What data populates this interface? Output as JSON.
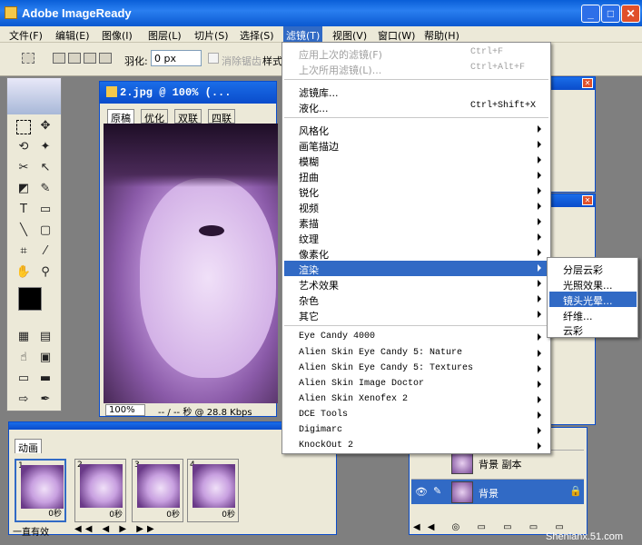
{
  "app": {
    "title": "Adobe ImageReady"
  },
  "menubar": [
    "文件(F)",
    "编辑(E)",
    "图像(I)",
    "图层(L)",
    "切片(S)",
    "选择(S)",
    "滤镜(T)",
    "视图(V)",
    "窗口(W)",
    "帮助(H)"
  ],
  "options": {
    "feather_label": "羽化:",
    "feather_value": "0 px",
    "antialias_label": "消除锯齿",
    "style_label": "样式"
  },
  "document": {
    "title": "2.jpg @ 100% (...",
    "tabs": [
      "原稿",
      "优化",
      "双联",
      "四联"
    ],
    "zoom": "100%",
    "status": "-- / -- 秒 @ 28.8 Kbps"
  },
  "filter_menu": {
    "top": [
      {
        "label": "应用上次的滤镜(F)",
        "shortcut": "Ctrl+F"
      },
      {
        "label": "上次所用滤镜(L)...",
        "shortcut": "Ctrl+Alt+F"
      }
    ],
    "mid": [
      {
        "label": "滤镜库..."
      },
      {
        "label": "液化...",
        "shortcut": "Ctrl+Shift+X"
      }
    ],
    "groups": [
      "风格化",
      "画笔描边",
      "模糊",
      "扭曲",
      "锐化",
      "视频",
      "素描",
      "纹理",
      "像素化",
      "渲染",
      "艺术效果",
      "杂色",
      "其它"
    ],
    "plugins": [
      "Eye Candy 4000",
      "Alien Skin Eye Candy 5: Nature",
      "Alien Skin Eye Candy 5: Textures",
      "Alien Skin Image Doctor",
      "Alien Skin Xenofex 2",
      "DCE Tools",
      "Digimarc",
      "KnockOut 2"
    ]
  },
  "render_submenu": [
    "分层云彩",
    "光照效果...",
    "镜头光晕...",
    "纤维...",
    "云彩"
  ],
  "animation": {
    "tab": "动画",
    "frames": [
      {
        "num": "1",
        "delay": "0秒"
      },
      {
        "num": "2",
        "delay": "0秒"
      },
      {
        "num": "3",
        "delay": "0秒"
      },
      {
        "num": "4",
        "delay": "0秒"
      }
    ],
    "loop": "一直有效"
  },
  "layers": [
    {
      "name": "背景 副本"
    },
    {
      "name": "背景"
    }
  ],
  "watermark": "Shenlanx.51.com",
  "colors": {
    "accent": "#316ac5",
    "titlebar": "#0a58d0"
  }
}
